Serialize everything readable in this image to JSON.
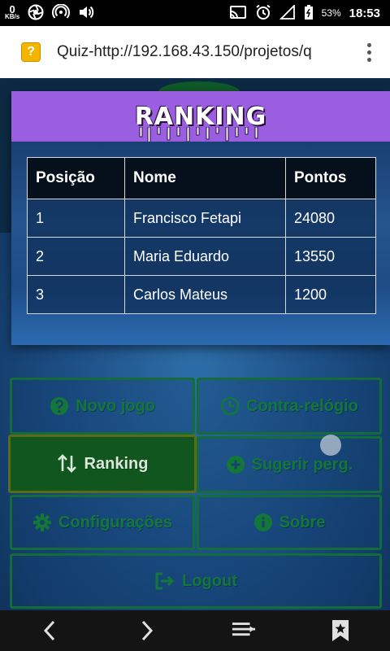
{
  "status_bar": {
    "net_speed_value": "0",
    "net_speed_unit": "KB/s",
    "battery_percent": "53%",
    "time": "18:53"
  },
  "browser": {
    "favicon_glyph": "?",
    "page_title": "Quiz-http://192.168.43.150/projetos/q"
  },
  "ranking": {
    "title": "RANKING",
    "columns": [
      "Posição",
      "Nome",
      "Pontos"
    ],
    "rows": [
      {
        "position": "1",
        "name": "Francisco Fetapi",
        "points": "24080"
      },
      {
        "position": "2",
        "name": "Maria Eduardo",
        "points": "13550"
      },
      {
        "position": "3",
        "name": "Carlos Mateus",
        "points": "1200"
      }
    ]
  },
  "menu": {
    "new_game": "Novo jogo",
    "time_trial": "Contra-relógio",
    "ranking": "Ranking",
    "suggest": "Sugerir perg.",
    "settings": "Configurações",
    "about": "Sobre",
    "logout": "Logout"
  },
  "colors": {
    "modal_header": "#9a5ee0",
    "button_border": "#136c3a",
    "button_text": "#13773a",
    "active_button": "#11561f"
  }
}
